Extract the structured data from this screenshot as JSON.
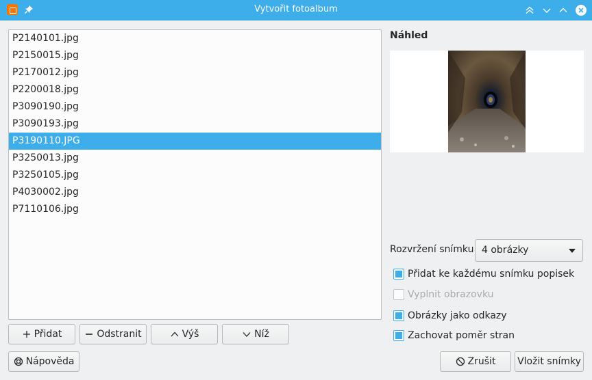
{
  "window": {
    "title": "Vytvořit fotoalbum"
  },
  "titlebar": {
    "icons": [
      "app-icon",
      "pin-icon",
      "keep-above-icon",
      "minimize-icon",
      "maximize-icon",
      "close-icon"
    ]
  },
  "files": [
    {
      "name": "P2140101.jpg",
      "selected": false
    },
    {
      "name": "P2150015.jpg",
      "selected": false
    },
    {
      "name": "P2170012.jpg",
      "selected": false
    },
    {
      "name": "P2200018.jpg",
      "selected": false
    },
    {
      "name": "P3090190.jpg",
      "selected": false
    },
    {
      "name": "P3090193.jpg",
      "selected": false
    },
    {
      "name": "P3190110.JPG",
      "selected": true
    },
    {
      "name": "P3250013.jpg",
      "selected": false
    },
    {
      "name": "P3250105.jpg",
      "selected": false
    },
    {
      "name": "P4030002.jpg",
      "selected": false
    },
    {
      "name": "P7110106.jpg",
      "selected": false
    }
  ],
  "list_buttons": {
    "add": "Přidat",
    "remove": "Odstranit",
    "up": "Výš",
    "down": "Níž"
  },
  "preview": {
    "title": "Náhled"
  },
  "layout": {
    "label": "Rozvržení snímku:",
    "value": "4 obrázky"
  },
  "options": {
    "caption": {
      "label": "Přidat ke každému snímku popisek",
      "checked": true,
      "enabled": true
    },
    "fill": {
      "label": "Vyplnit obrazovku",
      "checked": false,
      "enabled": false
    },
    "links": {
      "label": "Obrázky jako odkazy",
      "checked": true,
      "enabled": true
    },
    "ratio": {
      "label": "Zachovat poměr stran",
      "checked": true,
      "enabled": true
    }
  },
  "footer": {
    "help": "Nápověda",
    "cancel": "Zrušit",
    "insert": "Vložit snímky"
  },
  "colors": {
    "accent": "#3daee9",
    "background": "#eff0f1",
    "list_bg": "#fcfcfc"
  }
}
